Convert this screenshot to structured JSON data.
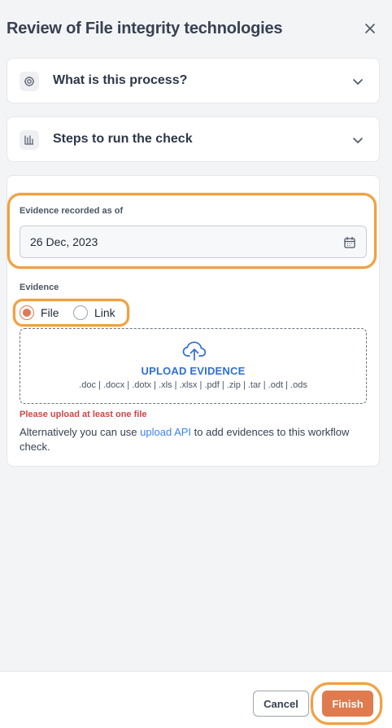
{
  "header": {
    "title": "Review of File integrity technologies",
    "close_icon": "close-icon"
  },
  "accordions": [
    {
      "label": "What is this process?",
      "icon": "gear-icon",
      "expanded": false
    },
    {
      "label": "Steps to run the check",
      "icon": "steps-icon",
      "expanded": false
    }
  ],
  "form": {
    "date_label": "Evidence recorded as of",
    "date_value": "26 Dec, 2023",
    "evidence_label": "Evidence",
    "radio_options": [
      {
        "label": "File",
        "selected": true
      },
      {
        "label": "Link",
        "selected": false
      }
    ],
    "upload": {
      "title": "UPLOAD EVIDENCE",
      "types": ".doc | .docx | .dotx | .xls | .xlsx | .pdf | .zip | .tar | .odt | .ods",
      "icon": "cloud-upload-icon"
    },
    "error": "Please upload at least one file",
    "help": {
      "before": "Alternatively you can use ",
      "link": "upload API",
      "after": " to add evidences to this workflow check."
    }
  },
  "footer": {
    "cancel_label": "Cancel",
    "finish_label": "Finish"
  },
  "colors": {
    "accent": "#e07a4f",
    "highlight": "#f0a040",
    "link": "#3b82f6",
    "error": "#d14545"
  }
}
